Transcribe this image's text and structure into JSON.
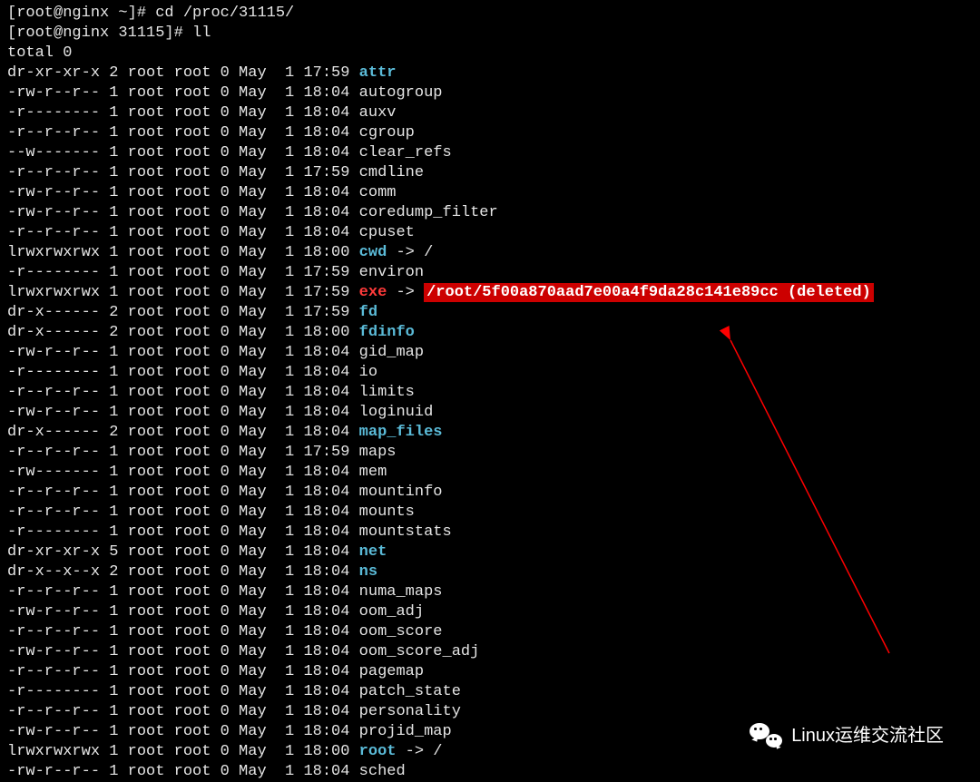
{
  "prompt1": {
    "host": "root@nginx",
    "dir": "~",
    "command": "cd /proc/31115/"
  },
  "prompt2": {
    "host": "root@nginx",
    "dir": "31115",
    "command": "ll"
  },
  "total": "total 0",
  "entries": [
    {
      "perms": "dr-xr-xr-x",
      "links": "2",
      "owner": "root",
      "group": "root",
      "size": "0",
      "month": "May",
      "day": " 1",
      "time": "17:59",
      "name": "attr",
      "type": "dir"
    },
    {
      "perms": "-rw-r--r--",
      "links": "1",
      "owner": "root",
      "group": "root",
      "size": "0",
      "month": "May",
      "day": " 1",
      "time": "18:04",
      "name": "autogroup",
      "type": "file"
    },
    {
      "perms": "-r--------",
      "links": "1",
      "owner": "root",
      "group": "root",
      "size": "0",
      "month": "May",
      "day": " 1",
      "time": "18:04",
      "name": "auxv",
      "type": "file"
    },
    {
      "perms": "-r--r--r--",
      "links": "1",
      "owner": "root",
      "group": "root",
      "size": "0",
      "month": "May",
      "day": " 1",
      "time": "18:04",
      "name": "cgroup",
      "type": "file"
    },
    {
      "perms": "--w-------",
      "links": "1",
      "owner": "root",
      "group": "root",
      "size": "0",
      "month": "May",
      "day": " 1",
      "time": "18:04",
      "name": "clear_refs",
      "type": "file"
    },
    {
      "perms": "-r--r--r--",
      "links": "1",
      "owner": "root",
      "group": "root",
      "size": "0",
      "month": "May",
      "day": " 1",
      "time": "17:59",
      "name": "cmdline",
      "type": "file"
    },
    {
      "perms": "-rw-r--r--",
      "links": "1",
      "owner": "root",
      "group": "root",
      "size": "0",
      "month": "May",
      "day": " 1",
      "time": "18:04",
      "name": "comm",
      "type": "file"
    },
    {
      "perms": "-rw-r--r--",
      "links": "1",
      "owner": "root",
      "group": "root",
      "size": "0",
      "month": "May",
      "day": " 1",
      "time": "18:04",
      "name": "coredump_filter",
      "type": "file"
    },
    {
      "perms": "-r--r--r--",
      "links": "1",
      "owner": "root",
      "group": "root",
      "size": "0",
      "month": "May",
      "day": " 1",
      "time": "18:04",
      "name": "cpuset",
      "type": "file"
    },
    {
      "perms": "lrwxrwxrwx",
      "links": "1",
      "owner": "root",
      "group": "root",
      "size": "0",
      "month": "May",
      "day": " 1",
      "time": "18:00",
      "name": "cwd",
      "type": "link",
      "target": "/",
      "link_color": "cyan"
    },
    {
      "perms": "-r--------",
      "links": "1",
      "owner": "root",
      "group": "root",
      "size": "0",
      "month": "May",
      "day": " 1",
      "time": "17:59",
      "name": "environ",
      "type": "file"
    },
    {
      "perms": "lrwxrwxrwx",
      "links": "1",
      "owner": "root",
      "group": "root",
      "size": "0",
      "month": "May",
      "day": " 1",
      "time": "17:59",
      "name": "exe",
      "type": "deleted-link",
      "target": "/root/5f00a870aad7e00a4f9da28c141e89cc (deleted)"
    },
    {
      "perms": "dr-x------",
      "links": "2",
      "owner": "root",
      "group": "root",
      "size": "0",
      "month": "May",
      "day": " 1",
      "time": "17:59",
      "name": "fd",
      "type": "dir"
    },
    {
      "perms": "dr-x------",
      "links": "2",
      "owner": "root",
      "group": "root",
      "size": "0",
      "month": "May",
      "day": " 1",
      "time": "18:00",
      "name": "fdinfo",
      "type": "dir"
    },
    {
      "perms": "-rw-r--r--",
      "links": "1",
      "owner": "root",
      "group": "root",
      "size": "0",
      "month": "May",
      "day": " 1",
      "time": "18:04",
      "name": "gid_map",
      "type": "file"
    },
    {
      "perms": "-r--------",
      "links": "1",
      "owner": "root",
      "group": "root",
      "size": "0",
      "month": "May",
      "day": " 1",
      "time": "18:04",
      "name": "io",
      "type": "file"
    },
    {
      "perms": "-r--r--r--",
      "links": "1",
      "owner": "root",
      "group": "root",
      "size": "0",
      "month": "May",
      "day": " 1",
      "time": "18:04",
      "name": "limits",
      "type": "file"
    },
    {
      "perms": "-rw-r--r--",
      "links": "1",
      "owner": "root",
      "group": "root",
      "size": "0",
      "month": "May",
      "day": " 1",
      "time": "18:04",
      "name": "loginuid",
      "type": "file"
    },
    {
      "perms": "dr-x------",
      "links": "2",
      "owner": "root",
      "group": "root",
      "size": "0",
      "month": "May",
      "day": " 1",
      "time": "18:04",
      "name": "map_files",
      "type": "dir"
    },
    {
      "perms": "-r--r--r--",
      "links": "1",
      "owner": "root",
      "group": "root",
      "size": "0",
      "month": "May",
      "day": " 1",
      "time": "17:59",
      "name": "maps",
      "type": "file"
    },
    {
      "perms": "-rw-------",
      "links": "1",
      "owner": "root",
      "group": "root",
      "size": "0",
      "month": "May",
      "day": " 1",
      "time": "18:04",
      "name": "mem",
      "type": "file"
    },
    {
      "perms": "-r--r--r--",
      "links": "1",
      "owner": "root",
      "group": "root",
      "size": "0",
      "month": "May",
      "day": " 1",
      "time": "18:04",
      "name": "mountinfo",
      "type": "file"
    },
    {
      "perms": "-r--r--r--",
      "links": "1",
      "owner": "root",
      "group": "root",
      "size": "0",
      "month": "May",
      "day": " 1",
      "time": "18:04",
      "name": "mounts",
      "type": "file"
    },
    {
      "perms": "-r--------",
      "links": "1",
      "owner": "root",
      "group": "root",
      "size": "0",
      "month": "May",
      "day": " 1",
      "time": "18:04",
      "name": "mountstats",
      "type": "file"
    },
    {
      "perms": "dr-xr-xr-x",
      "links": "5",
      "owner": "root",
      "group": "root",
      "size": "0",
      "month": "May",
      "day": " 1",
      "time": "18:04",
      "name": "net",
      "type": "dir"
    },
    {
      "perms": "dr-x--x--x",
      "links": "2",
      "owner": "root",
      "group": "root",
      "size": "0",
      "month": "May",
      "day": " 1",
      "time": "18:04",
      "name": "ns",
      "type": "dir"
    },
    {
      "perms": "-r--r--r--",
      "links": "1",
      "owner": "root",
      "group": "root",
      "size": "0",
      "month": "May",
      "day": " 1",
      "time": "18:04",
      "name": "numa_maps",
      "type": "file"
    },
    {
      "perms": "-rw-r--r--",
      "links": "1",
      "owner": "root",
      "group": "root",
      "size": "0",
      "month": "May",
      "day": " 1",
      "time": "18:04",
      "name": "oom_adj",
      "type": "file"
    },
    {
      "perms": "-r--r--r--",
      "links": "1",
      "owner": "root",
      "group": "root",
      "size": "0",
      "month": "May",
      "day": " 1",
      "time": "18:04",
      "name": "oom_score",
      "type": "file"
    },
    {
      "perms": "-rw-r--r--",
      "links": "1",
      "owner": "root",
      "group": "root",
      "size": "0",
      "month": "May",
      "day": " 1",
      "time": "18:04",
      "name": "oom_score_adj",
      "type": "file"
    },
    {
      "perms": "-r--r--r--",
      "links": "1",
      "owner": "root",
      "group": "root",
      "size": "0",
      "month": "May",
      "day": " 1",
      "time": "18:04",
      "name": "pagemap",
      "type": "file"
    },
    {
      "perms": "-r--------",
      "links": "1",
      "owner": "root",
      "group": "root",
      "size": "0",
      "month": "May",
      "day": " 1",
      "time": "18:04",
      "name": "patch_state",
      "type": "file"
    },
    {
      "perms": "-r--r--r--",
      "links": "1",
      "owner": "root",
      "group": "root",
      "size": "0",
      "month": "May",
      "day": " 1",
      "time": "18:04",
      "name": "personality",
      "type": "file"
    },
    {
      "perms": "-rw-r--r--",
      "links": "1",
      "owner": "root",
      "group": "root",
      "size": "0",
      "month": "May",
      "day": " 1",
      "time": "18:04",
      "name": "projid_map",
      "type": "file"
    },
    {
      "perms": "lrwxrwxrwx",
      "links": "1",
      "owner": "root",
      "group": "root",
      "size": "0",
      "month": "May",
      "day": " 1",
      "time": "18:00",
      "name": "root",
      "type": "link",
      "target": "/",
      "link_color": "cyan"
    },
    {
      "perms": "-rw-r--r--",
      "links": "1",
      "owner": "root",
      "group": "root",
      "size": "0",
      "month": "May",
      "day": " 1",
      "time": "18:04",
      "name": "sched",
      "type": "file"
    }
  ],
  "watermark_text": "Linux运维交流社区"
}
